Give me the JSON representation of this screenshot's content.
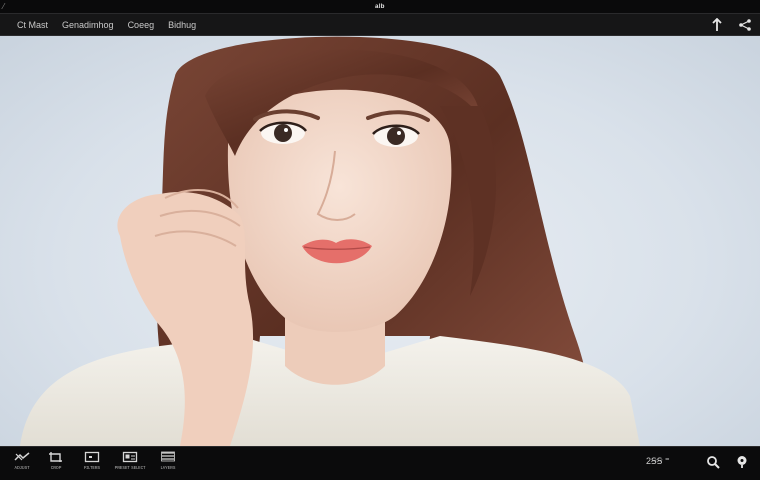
{
  "window": {
    "title": "ᵃˡᵇ"
  },
  "menu": {
    "items": [
      {
        "label": "Ct Mast"
      },
      {
        "label": "Genadimhog"
      },
      {
        "label": "Coeeg"
      },
      {
        "label": "Bidhug"
      }
    ]
  },
  "toolbar_right": {
    "icons": [
      "arrow-up-icon",
      "share-icon"
    ]
  },
  "bottom_tools": [
    {
      "label": "ᴀᴅᴊᴜꜱᴛ",
      "icon": "adjust-icon"
    },
    {
      "label": "ᴄʀᴏᴘ",
      "icon": "crop-icon"
    },
    {
      "label": "ꜰɪʟᴛᴇʀꜱ",
      "icon": "filters-icon"
    },
    {
      "label": "ᴘʀᴇꜱᴇᴛ ꜱᴇʟᴇᴄᴛ",
      "icon": "preset-icon"
    },
    {
      "label": "ʟᴀʏᴇʀꜱ",
      "icon": "layers-icon"
    }
  ],
  "status": {
    "text": "2ꞨꞨ ⁼"
  },
  "bottom_right": {
    "icons": [
      "search-icon",
      "info-icon"
    ]
  },
  "colors": {
    "background": "#0d0d0e",
    "canvas": "#d9e1ea",
    "hair": "#6a3a2a",
    "skin": "#f0d6c8"
  }
}
